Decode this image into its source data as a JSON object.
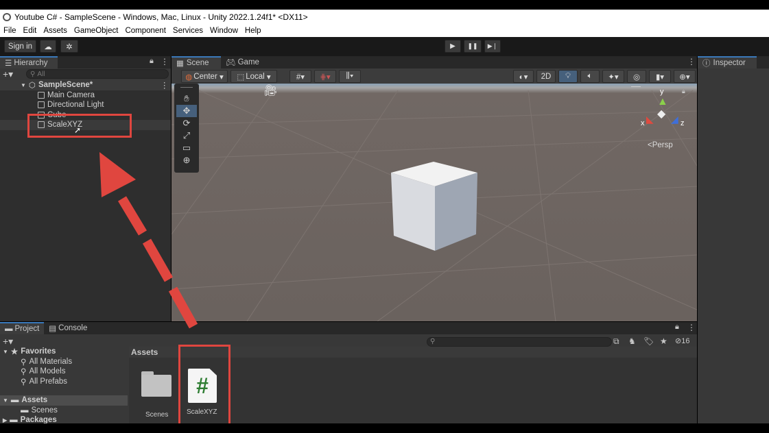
{
  "window": {
    "title": "Youtube C# - SampleScene - Windows, Mac, Linux - Unity 2022.1.24f1* <DX11>"
  },
  "menu": [
    "File",
    "Edit",
    "Assets",
    "GameObject",
    "Component",
    "Services",
    "Window",
    "Help"
  ],
  "toolbar": {
    "sign_in": "Sign in",
    "cloud_icon": "cloud-icon",
    "collab_icon": "collab-icon",
    "play": "▶",
    "pause": "❚❚",
    "step": "▶❘"
  },
  "hierarchy": {
    "tab": "Hierarchy",
    "search_placeholder": "All",
    "scene": "SampleScene*",
    "items": [
      "Main Camera",
      "Directional Light",
      "Cube",
      "ScaleXYZ"
    ]
  },
  "scene_view": {
    "tabs": [
      "Scene",
      "Game"
    ],
    "pivot": "Center",
    "space": "Local",
    "mode_2d": "2D",
    "persp_label": "<Persp",
    "gizmo_axes": {
      "x": "x",
      "y": "y",
      "z": "z"
    }
  },
  "inspector": {
    "tab": "Inspector"
  },
  "project": {
    "tabs": [
      "Project",
      "Console"
    ],
    "favorites": {
      "label": "Favorites",
      "items": [
        "All Materials",
        "All Models",
        "All Prefabs"
      ]
    },
    "assets_tree": {
      "label": "Assets",
      "children": [
        "Scenes"
      ]
    },
    "packages": "Packages",
    "breadcrumb": "Assets",
    "files": [
      {
        "name": "Scenes",
        "type": "folder"
      },
      {
        "name": "ScaleXYZ",
        "type": "script",
        "glyph": "#"
      }
    ],
    "hidden_count": "16"
  },
  "colors": {
    "accent": "#3a79bb",
    "annotation": "#e0463f",
    "script_hash": "#2e7d32"
  }
}
